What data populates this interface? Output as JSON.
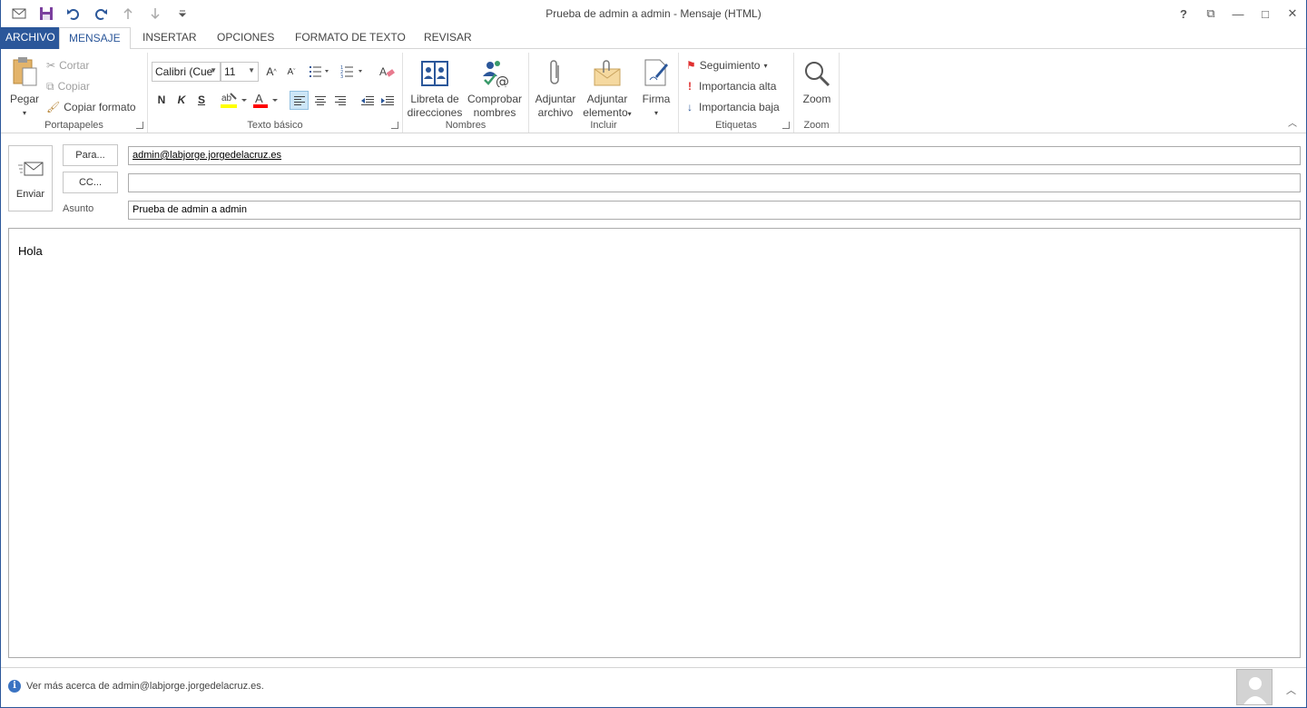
{
  "window": {
    "title": "Prueba de admin a admin - Mensaje (HTML)",
    "controls": {
      "help": "?",
      "restore_ribbon": "⧉",
      "minimize": "—",
      "maximize": "□",
      "close": "✕"
    }
  },
  "quick_access": [
    "send-receive",
    "save",
    "undo",
    "redo",
    "previous",
    "next",
    "customize"
  ],
  "tabs": {
    "file": "ARCHIVO",
    "message": "MENSAJE",
    "insert": "INSERTAR",
    "options": "OPCIONES",
    "format": "FORMATO DE TEXTO",
    "review": "REVISAR"
  },
  "ribbon": {
    "clipboard": {
      "label": "Portapapeles",
      "paste": "Pegar",
      "cut": "Cortar",
      "copy": "Copiar",
      "format_painter": "Copiar formato"
    },
    "basic_text": {
      "label": "Texto básico",
      "font": "Calibri (Cue",
      "size": "11",
      "bold": "N",
      "italic": "K",
      "underline": "S"
    },
    "names": {
      "label": "Nombres",
      "address_book_1": "Libreta de",
      "address_book_2": "direcciones",
      "check_names_1": "Comprobar",
      "check_names_2": "nombres"
    },
    "include": {
      "label": "Incluir",
      "attach_file_1": "Adjuntar",
      "attach_file_2": "archivo",
      "attach_item_1": "Adjuntar",
      "attach_item_2": "elemento",
      "signature": "Firma"
    },
    "tags": {
      "label": "Etiquetas",
      "follow_up": "Seguimiento",
      "high_importance": "Importancia alta",
      "low_importance": "Importancia baja"
    },
    "zoom": {
      "label": "Zoom",
      "zoom": "Zoom"
    },
    "colors": {
      "highlight": "#ffff00",
      "font_color": "#ff0000",
      "accent": "#2b579a"
    }
  },
  "compose": {
    "send": "Enviar",
    "to_button": "Para...",
    "cc_button": "CC...",
    "subject_label": "Asunto",
    "to_value": "admin@labjorge.jorgedelacruz.es",
    "cc_value": "",
    "subject_value": "Prueba de admin a admin",
    "body_text": "Hola"
  },
  "status": {
    "text": "Ver más acerca de admin@labjorge.jorgedelacruz.es."
  }
}
